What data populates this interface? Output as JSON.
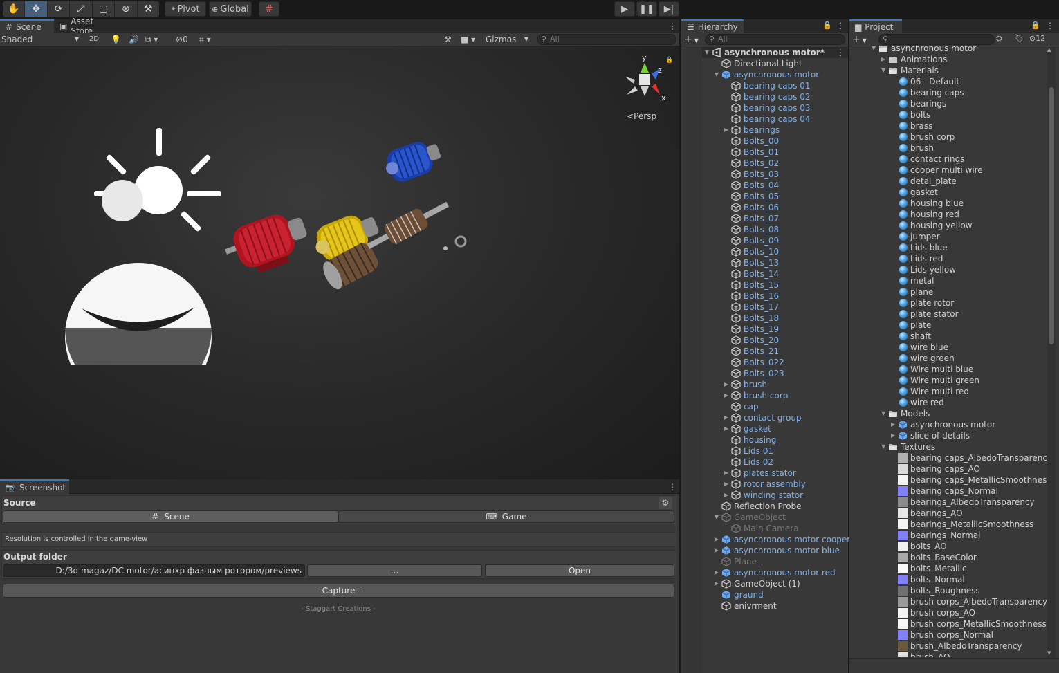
{
  "toolbar": {
    "pivot_label": "Pivot",
    "global_label": "Global"
  },
  "scene": {
    "tab_label": "Scene",
    "asset_store_label": "Asset Store",
    "shading_mode": "Shaded",
    "mode_2d": "2D",
    "hidden_count": "0",
    "gizmos_label": "Gizmos",
    "search_placeholder": "All",
    "persp_label": "Persp",
    "axis_x": "x",
    "axis_y": "y",
    "axis_z": "z"
  },
  "hierarchy": {
    "tab_label": "Hierarchy",
    "search_placeholder": "All",
    "rows": [
      {
        "label": "asynchronous motor*",
        "indent": 0,
        "arrow": "open",
        "icon": "scene",
        "color": "white",
        "bold": true
      },
      {
        "label": "Directional Light",
        "indent": 1,
        "arrow": "",
        "icon": "cube",
        "color": "white"
      },
      {
        "label": "asynchronous motor",
        "indent": 1,
        "arrow": "open",
        "icon": "prefab",
        "color": "blue"
      },
      {
        "label": "bearing caps 01",
        "indent": 2,
        "arrow": "",
        "icon": "cube",
        "color": "blue"
      },
      {
        "label": "bearing caps 02",
        "indent": 2,
        "arrow": "",
        "icon": "cube",
        "color": "blue"
      },
      {
        "label": "bearing caps 03",
        "indent": 2,
        "arrow": "",
        "icon": "cube",
        "color": "blue"
      },
      {
        "label": "bearing caps 04",
        "indent": 2,
        "arrow": "",
        "icon": "cube",
        "color": "blue"
      },
      {
        "label": "bearings",
        "indent": 2,
        "arrow": "closed",
        "icon": "cube",
        "color": "blue"
      },
      {
        "label": "Bolts_00",
        "indent": 2,
        "arrow": "",
        "icon": "cube",
        "color": "blue"
      },
      {
        "label": "Bolts_01",
        "indent": 2,
        "arrow": "",
        "icon": "cube",
        "color": "blue"
      },
      {
        "label": "Bolts_02",
        "indent": 2,
        "arrow": "",
        "icon": "cube",
        "color": "blue"
      },
      {
        "label": "Bolts_03",
        "indent": 2,
        "arrow": "",
        "icon": "cube",
        "color": "blue"
      },
      {
        "label": "Bolts_04",
        "indent": 2,
        "arrow": "",
        "icon": "cube",
        "color": "blue"
      },
      {
        "label": "Bolts_05",
        "indent": 2,
        "arrow": "",
        "icon": "cube",
        "color": "blue"
      },
      {
        "label": "Bolts_06",
        "indent": 2,
        "arrow": "",
        "icon": "cube",
        "color": "blue"
      },
      {
        "label": "Bolts_07",
        "indent": 2,
        "arrow": "",
        "icon": "cube",
        "color": "blue"
      },
      {
        "label": "Bolts_08",
        "indent": 2,
        "arrow": "",
        "icon": "cube",
        "color": "blue"
      },
      {
        "label": "Bolts_09",
        "indent": 2,
        "arrow": "",
        "icon": "cube",
        "color": "blue"
      },
      {
        "label": "Bolts_10",
        "indent": 2,
        "arrow": "",
        "icon": "cube",
        "color": "blue"
      },
      {
        "label": "Bolts_13",
        "indent": 2,
        "arrow": "",
        "icon": "cube",
        "color": "blue"
      },
      {
        "label": "Bolts_14",
        "indent": 2,
        "arrow": "",
        "icon": "cube",
        "color": "blue"
      },
      {
        "label": "Bolts_15",
        "indent": 2,
        "arrow": "",
        "icon": "cube",
        "color": "blue"
      },
      {
        "label": "Bolts_16",
        "indent": 2,
        "arrow": "",
        "icon": "cube",
        "color": "blue"
      },
      {
        "label": "Bolts_17",
        "indent": 2,
        "arrow": "",
        "icon": "cube",
        "color": "blue"
      },
      {
        "label": "Bolts_18",
        "indent": 2,
        "arrow": "",
        "icon": "cube",
        "color": "blue"
      },
      {
        "label": "Bolts_19",
        "indent": 2,
        "arrow": "",
        "icon": "cube",
        "color": "blue"
      },
      {
        "label": "Bolts_20",
        "indent": 2,
        "arrow": "",
        "icon": "cube",
        "color": "blue"
      },
      {
        "label": "Bolts_21",
        "indent": 2,
        "arrow": "",
        "icon": "cube",
        "color": "blue"
      },
      {
        "label": "Bolts_022",
        "indent": 2,
        "arrow": "",
        "icon": "cube",
        "color": "blue"
      },
      {
        "label": "Bolts_023",
        "indent": 2,
        "arrow": "",
        "icon": "cube",
        "color": "blue"
      },
      {
        "label": "brush",
        "indent": 2,
        "arrow": "closed",
        "icon": "cube",
        "color": "blue"
      },
      {
        "label": "brush corp",
        "indent": 2,
        "arrow": "closed",
        "icon": "cube",
        "color": "blue"
      },
      {
        "label": "cap",
        "indent": 2,
        "arrow": "",
        "icon": "cube",
        "color": "blue"
      },
      {
        "label": "contact group",
        "indent": 2,
        "arrow": "closed",
        "icon": "cube",
        "color": "blue"
      },
      {
        "label": "gasket",
        "indent": 2,
        "arrow": "closed",
        "icon": "cube",
        "color": "blue"
      },
      {
        "label": "housing",
        "indent": 2,
        "arrow": "",
        "icon": "cube",
        "color": "blue"
      },
      {
        "label": "Lids 01",
        "indent": 2,
        "arrow": "",
        "icon": "cube",
        "color": "blue"
      },
      {
        "label": "Lids 02",
        "indent": 2,
        "arrow": "",
        "icon": "cube",
        "color": "blue"
      },
      {
        "label": "plates stator",
        "indent": 2,
        "arrow": "closed",
        "icon": "cube",
        "color": "blue"
      },
      {
        "label": "rotor assembly",
        "indent": 2,
        "arrow": "closed",
        "icon": "cube",
        "color": "blue"
      },
      {
        "label": "winding stator",
        "indent": 2,
        "arrow": "closed",
        "icon": "cube",
        "color": "blue"
      },
      {
        "label": "Reflection Probe",
        "indent": 1,
        "arrow": "",
        "icon": "cube",
        "color": "white"
      },
      {
        "label": "GameObject",
        "indent": 1,
        "arrow": "open",
        "icon": "cube",
        "color": "gray"
      },
      {
        "label": "Main Camera",
        "indent": 2,
        "arrow": "",
        "icon": "cube",
        "color": "gray"
      },
      {
        "label": "asynchronous motor cooper",
        "indent": 1,
        "arrow": "closed",
        "icon": "prefab",
        "color": "blue"
      },
      {
        "label": "asynchronous motor blue",
        "indent": 1,
        "arrow": "closed",
        "icon": "prefab",
        "color": "blue"
      },
      {
        "label": "Plane",
        "indent": 1,
        "arrow": "",
        "icon": "cube",
        "color": "gray"
      },
      {
        "label": "asynchronous motor red",
        "indent": 1,
        "arrow": "closed",
        "icon": "prefab",
        "color": "blue"
      },
      {
        "label": "GameObject (1)",
        "indent": 1,
        "arrow": "closed",
        "icon": "cube",
        "color": "white"
      },
      {
        "label": "graund",
        "indent": 1,
        "arrow": "",
        "icon": "prefab",
        "color": "blue"
      },
      {
        "label": "enivrment",
        "indent": 1,
        "arrow": "",
        "icon": "cube",
        "color": "white"
      }
    ]
  },
  "project": {
    "tab_label": "Project",
    "hidden_count": "12",
    "rows": [
      {
        "label": "asynchronous motor",
        "indent": 0,
        "arrow": "open",
        "icon": "folder-open"
      },
      {
        "label": "Animations",
        "indent": 1,
        "arrow": "closed",
        "icon": "folder"
      },
      {
        "label": "Materials",
        "indent": 1,
        "arrow": "open",
        "icon": "folder-open"
      },
      {
        "label": "06 - Default",
        "indent": 2,
        "arrow": "",
        "icon": "material"
      },
      {
        "label": "bearing caps",
        "indent": 2,
        "arrow": "",
        "icon": "material"
      },
      {
        "label": "bearings",
        "indent": 2,
        "arrow": "",
        "icon": "material"
      },
      {
        "label": "bolts",
        "indent": 2,
        "arrow": "",
        "icon": "material"
      },
      {
        "label": "brass",
        "indent": 2,
        "arrow": "",
        "icon": "material"
      },
      {
        "label": "brush corp",
        "indent": 2,
        "arrow": "",
        "icon": "material"
      },
      {
        "label": "brush",
        "indent": 2,
        "arrow": "",
        "icon": "material"
      },
      {
        "label": "contact rings",
        "indent": 2,
        "arrow": "",
        "icon": "material"
      },
      {
        "label": "cooper multi wire",
        "indent": 2,
        "arrow": "",
        "icon": "material"
      },
      {
        "label": "detal_plate",
        "indent": 2,
        "arrow": "",
        "icon": "material"
      },
      {
        "label": "gasket",
        "indent": 2,
        "arrow": "",
        "icon": "material"
      },
      {
        "label": "housing blue",
        "indent": 2,
        "arrow": "",
        "icon": "material"
      },
      {
        "label": "housing red",
        "indent": 2,
        "arrow": "",
        "icon": "material"
      },
      {
        "label": "housing yellow",
        "indent": 2,
        "arrow": "",
        "icon": "material"
      },
      {
        "label": "jumper",
        "indent": 2,
        "arrow": "",
        "icon": "material"
      },
      {
        "label": "Lids blue",
        "indent": 2,
        "arrow": "",
        "icon": "material"
      },
      {
        "label": "Lids red",
        "indent": 2,
        "arrow": "",
        "icon": "material"
      },
      {
        "label": "Lids yellow",
        "indent": 2,
        "arrow": "",
        "icon": "material"
      },
      {
        "label": "metal",
        "indent": 2,
        "arrow": "",
        "icon": "material"
      },
      {
        "label": "plane",
        "indent": 2,
        "arrow": "",
        "icon": "material"
      },
      {
        "label": "plate rotor",
        "indent": 2,
        "arrow": "",
        "icon": "material"
      },
      {
        "label": "plate stator",
        "indent": 2,
        "arrow": "",
        "icon": "material"
      },
      {
        "label": "plate",
        "indent": 2,
        "arrow": "",
        "icon": "material"
      },
      {
        "label": "shaft",
        "indent": 2,
        "arrow": "",
        "icon": "material"
      },
      {
        "label": "wire blue",
        "indent": 2,
        "arrow": "",
        "icon": "material"
      },
      {
        "label": "wire green",
        "indent": 2,
        "arrow": "",
        "icon": "material"
      },
      {
        "label": "Wire multi blue",
        "indent": 2,
        "arrow": "",
        "icon": "material"
      },
      {
        "label": "Wire multi green",
        "indent": 2,
        "arrow": "",
        "icon": "material"
      },
      {
        "label": "Wire multi red",
        "indent": 2,
        "arrow": "",
        "icon": "material"
      },
      {
        "label": "wire red",
        "indent": 2,
        "arrow": "",
        "icon": "material"
      },
      {
        "label": "Models",
        "indent": 1,
        "arrow": "open",
        "icon": "folder-open"
      },
      {
        "label": "asynchronous motor",
        "indent": 2,
        "arrow": "closed",
        "icon": "model"
      },
      {
        "label": "slice of details",
        "indent": 2,
        "arrow": "closed",
        "icon": "model"
      },
      {
        "label": "Textures",
        "indent": 1,
        "arrow": "open",
        "icon": "folder-open"
      },
      {
        "label": "bearing caps_AlbedoTransparency",
        "indent": 2,
        "arrow": "",
        "icon": "texture",
        "swatch": "#b0b0b0"
      },
      {
        "label": "bearing caps_AO",
        "indent": 2,
        "arrow": "",
        "icon": "texture",
        "swatch": "#d8d8d8"
      },
      {
        "label": "bearing caps_MetallicSmoothness",
        "indent": 2,
        "arrow": "",
        "icon": "texture",
        "swatch": "#f4f4f4"
      },
      {
        "label": "bearing caps_Normal",
        "indent": 2,
        "arrow": "",
        "icon": "texture",
        "swatch": "#8080ff"
      },
      {
        "label": "bearings_AlbedoTransparency",
        "indent": 2,
        "arrow": "",
        "icon": "texture",
        "swatch": "#8a8a8a"
      },
      {
        "label": "bearings_AO",
        "indent": 2,
        "arrow": "",
        "icon": "texture",
        "swatch": "#e8e8e8"
      },
      {
        "label": "bearings_MetallicSmoothness",
        "indent": 2,
        "arrow": "",
        "icon": "texture",
        "swatch": "#f4f4f4"
      },
      {
        "label": "bearings_Normal",
        "indent": 2,
        "arrow": "",
        "icon": "texture",
        "swatch": "#8080ff"
      },
      {
        "label": "bolts_AO",
        "indent": 2,
        "arrow": "",
        "icon": "texture",
        "swatch": "#f0f0f0"
      },
      {
        "label": "bolts_BaseColor",
        "indent": 2,
        "arrow": "",
        "icon": "texture",
        "swatch": "#a8a8a8"
      },
      {
        "label": "bolts_Metallic",
        "indent": 2,
        "arrow": "",
        "icon": "texture",
        "swatch": "#fafafa"
      },
      {
        "label": "bolts_Normal",
        "indent": 2,
        "arrow": "",
        "icon": "texture",
        "swatch": "#8080ff"
      },
      {
        "label": "bolts_Roughness",
        "indent": 2,
        "arrow": "",
        "icon": "texture",
        "swatch": "#707070"
      },
      {
        "label": "brush corps_AlbedoTransparency",
        "indent": 2,
        "arrow": "",
        "icon": "texture",
        "swatch": "#9a9a9a"
      },
      {
        "label": "brush corps_AO",
        "indent": 2,
        "arrow": "",
        "icon": "texture",
        "swatch": "#f2f2f2"
      },
      {
        "label": "brush corps_MetallicSmoothness",
        "indent": 2,
        "arrow": "",
        "icon": "texture",
        "swatch": "#f6f6f6"
      },
      {
        "label": "brush corps_Normal",
        "indent": 2,
        "arrow": "",
        "icon": "texture",
        "swatch": "#8080ff"
      },
      {
        "label": "brush_AlbedoTransparency",
        "indent": 2,
        "arrow": "",
        "icon": "texture",
        "swatch": "#6a5a3a"
      },
      {
        "label": "brush_AO",
        "indent": 2,
        "arrow": "",
        "icon": "texture",
        "swatch": "#e0e0e0"
      }
    ]
  },
  "screenshot": {
    "tab_label": "Screenshot",
    "source_label": "Source",
    "scene_btn": "Scene",
    "game_btn": "Game",
    "resolution_note": "Resolution is controlled in the game-view",
    "output_folder_label": "Output folder",
    "output_path": "D:/3d magaz/DC motor/асинхр фазным ротором/previews",
    "browse_btn": "...",
    "open_btn": "Open",
    "capture_btn": "- Capture -",
    "footer": "- Staggart Creations -"
  }
}
